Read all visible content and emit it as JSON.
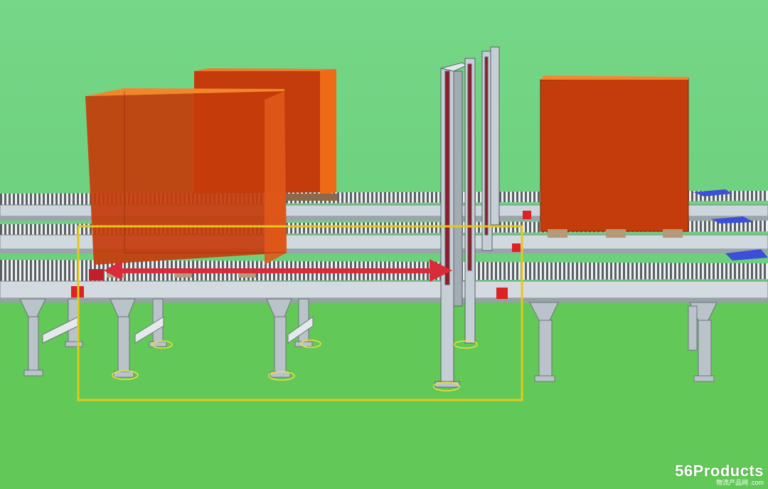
{
  "scene": {
    "description_visible": false,
    "colors": {
      "sky": "#72d583",
      "ground": "#63c95a",
      "pallet_load": "#c2410c",
      "highlight_box": "#e3c81d",
      "motion_arrow": "#d92b3a",
      "conveyor_frame": "#c9d3da",
      "legs": "#b7c1c7"
    },
    "icons": [
      "red-double-arrow",
      "yellow-highlight-box",
      "conveyor-roller-line",
      "pallet-load-box",
      "vertical-lift-column"
    ]
  },
  "watermark": {
    "main": "56Products",
    "sub": "物流产品网 .com"
  }
}
